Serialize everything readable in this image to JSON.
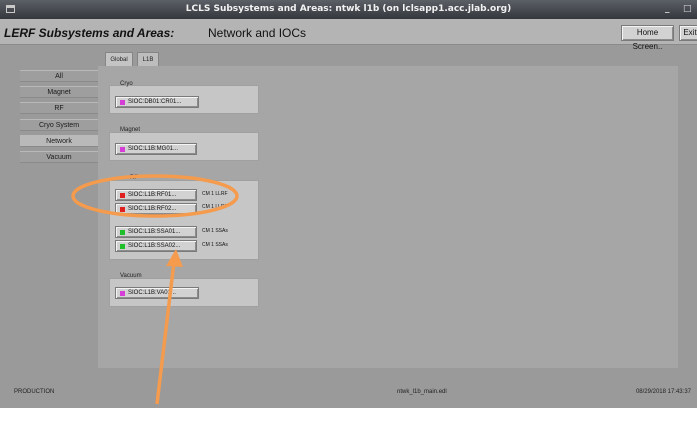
{
  "window": {
    "title": "LCLS Subsystems and Areas: ntwk l1b (on lclsapp1.acc.jlab.org)",
    "minimize_glyph": "_",
    "maximize_glyph": "□"
  },
  "header": {
    "title": "LERF Subsystems and Areas:",
    "subtitle": "Network and IOCs",
    "home_button": "Home Screen..",
    "exit_button": "Exit"
  },
  "tabs": [
    {
      "label": "Global",
      "active": false
    },
    {
      "label": "L1B",
      "active": true
    }
  ],
  "sidebar": {
    "items": [
      {
        "label": "All",
        "active": false
      },
      {
        "label": "Magnet",
        "active": false
      },
      {
        "label": "RF",
        "active": false
      },
      {
        "label": "Cryo System",
        "active": false
      },
      {
        "label": "Network",
        "active": true
      },
      {
        "label": "Vacuum",
        "active": false
      }
    ]
  },
  "groups": [
    {
      "label": "Cryo",
      "iocs": [
        {
          "label": "SIOC:DB01:CR01...",
          "status_color": "#d63dd6"
        }
      ]
    },
    {
      "label": "Magnet",
      "iocs": [
        {
          "label": "SIOC:L1B:MG01...",
          "status_color": "#d63dd6"
        }
      ]
    },
    {
      "label": "RF",
      "iocs": [
        {
          "label": "SIOC:L1B:RF01...",
          "status_color": "#e0201e",
          "note": "CM 1 LLRF"
        },
        {
          "label": "SIOC:L1B:RF02...",
          "status_color": "#e0201e",
          "note": "CM 1 LLRF"
        },
        {
          "label": "SIOC:L1B:SSA01...",
          "status_color": "#1fbf2a",
          "note": "CM 1 SSAs"
        },
        {
          "label": "SIOC:L1B:SSA02...",
          "status_color": "#1fbf2a",
          "note": "CM 1 SSAs"
        }
      ]
    },
    {
      "label": "Vacuum",
      "iocs": [
        {
          "label": "SIOC:L1B:VA01...",
          "status_color": "#d63dd6"
        }
      ]
    }
  ],
  "footer": {
    "mode": "PRODUCTION",
    "filename": "ntwk_l1b_main.edl",
    "timestamp": "08/29/2018 17:43:37"
  },
  "annotation": {
    "color": "#f49b4e"
  }
}
